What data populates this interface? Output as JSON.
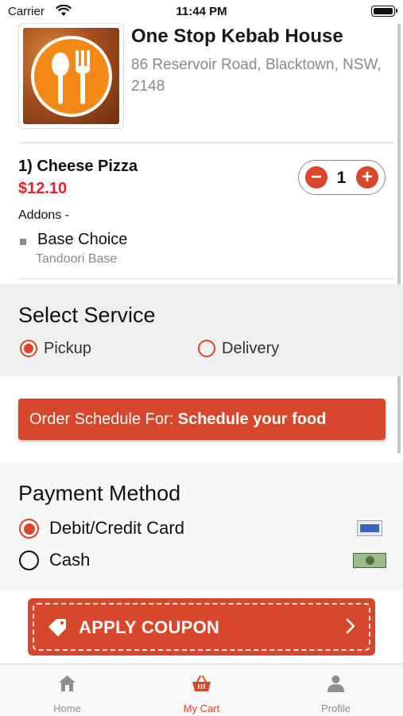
{
  "status_bar": {
    "carrier": "Carrier",
    "time": "11:44 PM"
  },
  "restaurant": {
    "name": "One Stop Kebab House",
    "address": "86 Reservoir Road, Blacktown, NSW, 2148"
  },
  "cart_item": {
    "title": "1) Cheese Pizza",
    "price": "$12.10",
    "quantity": "1",
    "addons_heading": "Addons -",
    "addon_name": "Base Choice",
    "addon_value": "Tandoori Base"
  },
  "service": {
    "title": "Select Service",
    "options": [
      {
        "label": "Pickup",
        "selected": true
      },
      {
        "label": "Delivery",
        "selected": false
      }
    ]
  },
  "schedule": {
    "prefix": "Order Schedule For: ",
    "value": "Schedule your food"
  },
  "payment": {
    "title": "Payment Method",
    "options": [
      {
        "label": "Debit/Credit Card",
        "selected": true,
        "icon": "credit-card-icon"
      },
      {
        "label": "Cash",
        "selected": false,
        "icon": "cash-icon"
      }
    ]
  },
  "coupon": {
    "label": "APPLY COUPON"
  },
  "tabs": [
    {
      "label": "Home",
      "icon": "home-icon",
      "active": false
    },
    {
      "label": "My Cart",
      "icon": "basket-icon",
      "active": true
    },
    {
      "label": "Profile",
      "icon": "profile-icon",
      "active": false
    }
  ],
  "colors": {
    "accent": "#d7472b",
    "price": "#e0242f",
    "muted": "#8a8a8a",
    "logo_orange": "#f38a17"
  }
}
